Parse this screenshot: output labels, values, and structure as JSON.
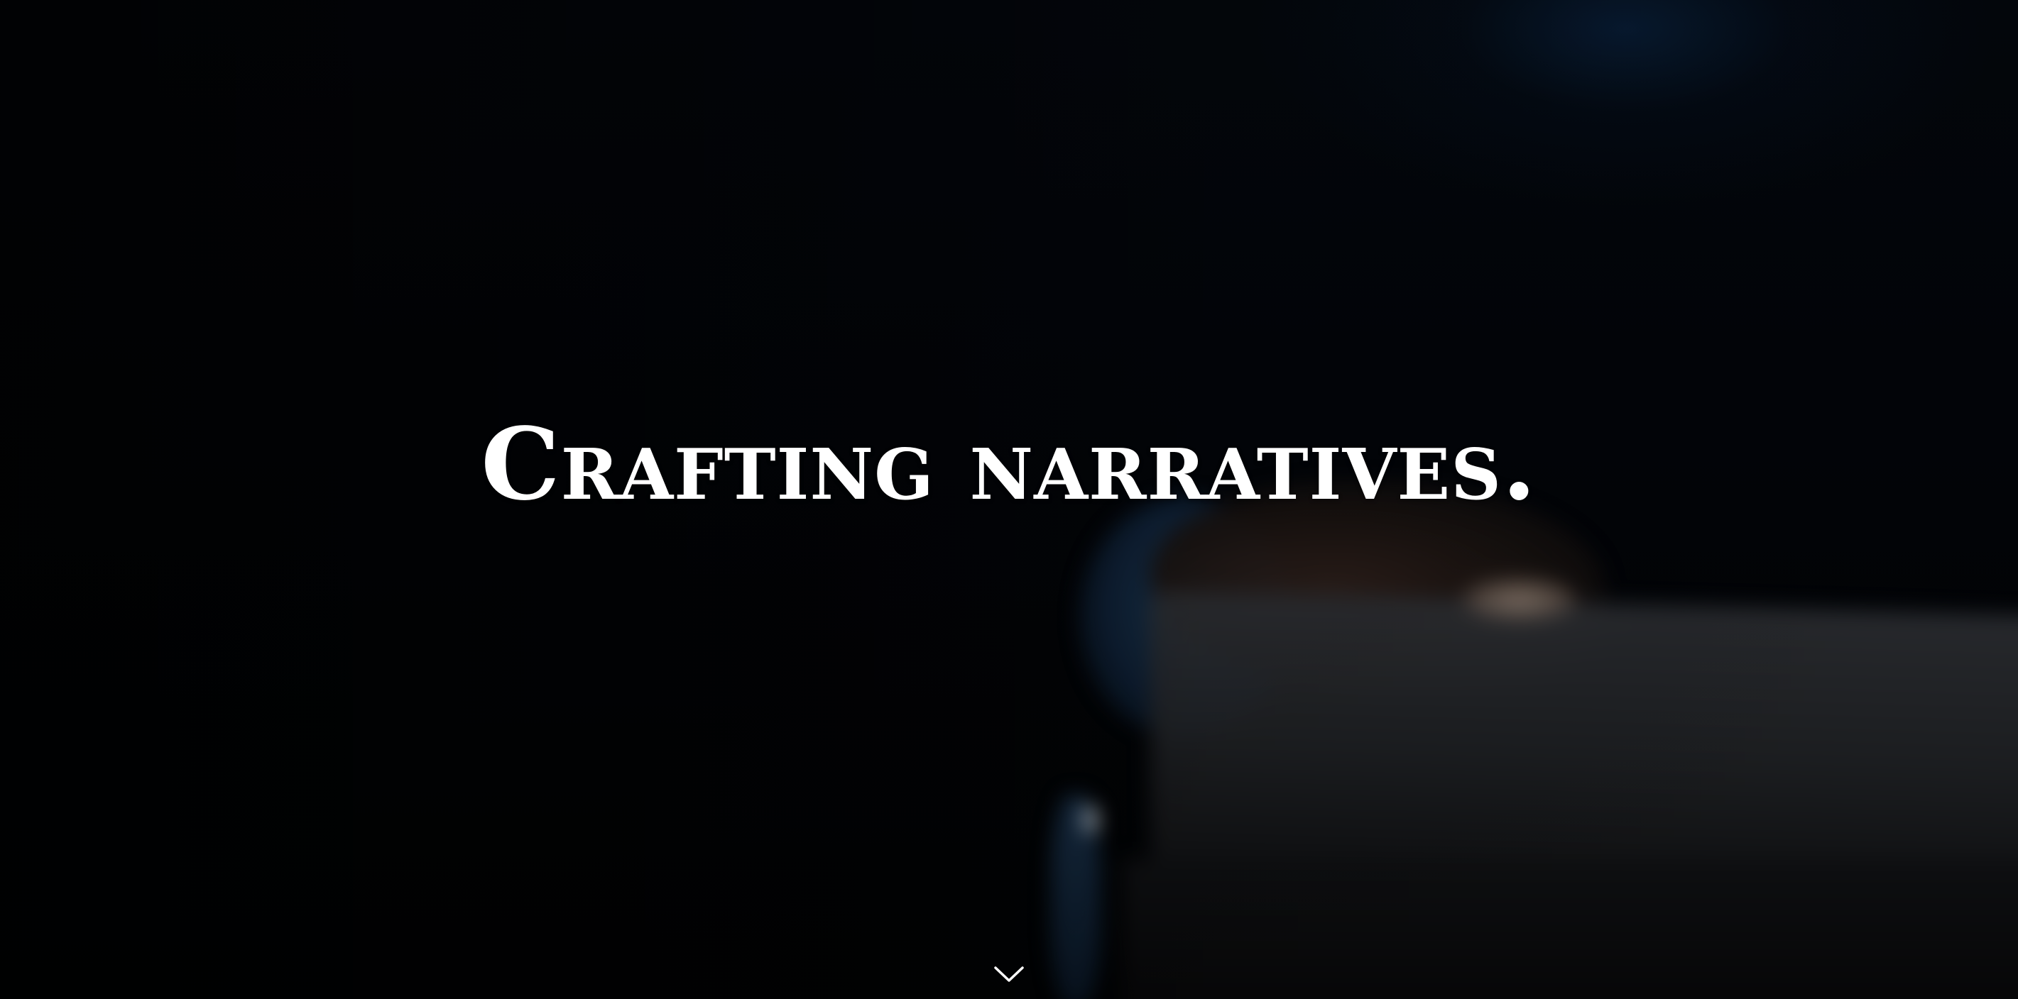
{
  "hero": {
    "headline": "Crafting narratives.",
    "scroll_icon": "chevron-down-icon"
  },
  "colors": {
    "background": "#000000",
    "headline": "#ffffff",
    "accent_glow": "#0a284b"
  }
}
